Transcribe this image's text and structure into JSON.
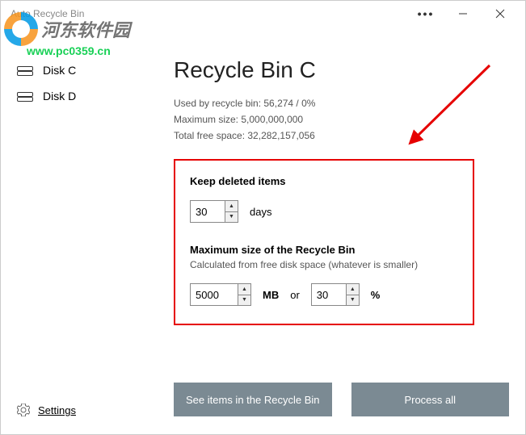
{
  "window": {
    "title": "Auto Recycle Bin"
  },
  "sidebar": {
    "items": [
      {
        "label": "Disk C"
      },
      {
        "label": "Disk D"
      }
    ],
    "settings_label": "Settings"
  },
  "main": {
    "title": "Recycle Bin C",
    "info": {
      "used_label": "Used by recycle bin: 56,274 / 0%",
      "max_label": "Maximum size: 5,000,000,000",
      "free_label": "Total free space: 32,282,157,056"
    },
    "keep": {
      "heading": "Keep deleted items",
      "value": "30",
      "unit": "days"
    },
    "maxsize": {
      "heading": "Maximum size of the Recycle Bin",
      "subtext": "Calculated from free disk space (whatever is smaller)",
      "mb_value": "5000",
      "mb_unit": "MB",
      "or_label": "or",
      "pct_value": "30",
      "pct_unit": "%"
    },
    "buttons": {
      "see_items": "See items in the Recycle Bin",
      "process_all": "Process all"
    }
  },
  "watermark": {
    "text": "河东软件园",
    "url": "www.pc0359.cn"
  }
}
